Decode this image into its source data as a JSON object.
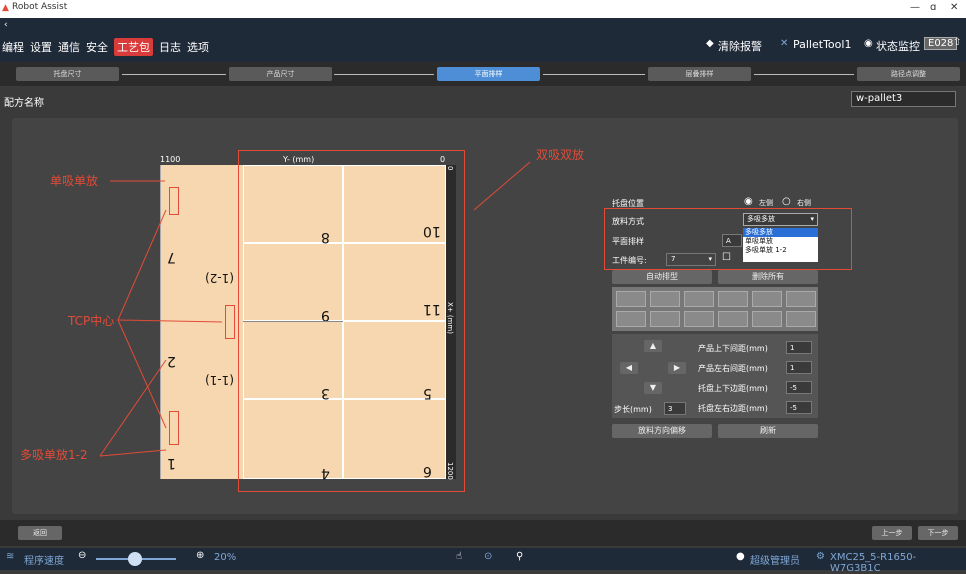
{
  "app_title": "Robot Assist",
  "window_controls": {
    "minimize": "—",
    "restore": "ɑ",
    "close": "✕"
  },
  "menu": {
    "items": [
      "编程",
      "设置",
      "通信",
      "安全",
      "工艺包",
      "日志",
      "选项"
    ],
    "active_index": 4
  },
  "toolbar": {
    "clear_alarm": "清除报警",
    "tool": "PalletTool1",
    "status_monitor": "状态监控",
    "code": "E028"
  },
  "steps": [
    "托盘尺寸",
    "产品尺寸",
    "平面排样",
    "层叠排样",
    "路径点调整"
  ],
  "active_step": 2,
  "recipe": {
    "label": "配方名称",
    "value": "w-pallet3"
  },
  "pallet": {
    "y_axis": "Y- (mm)",
    "x_axis": "X+ (mm)",
    "y_max": "1100",
    "y_min": "0",
    "x_min": "0",
    "x_max": "1200",
    "labels": {
      "c1": "1",
      "c2": "2",
      "c3": "3",
      "c4": "4",
      "c5": "5",
      "c6": "6",
      "c7": "7",
      "c8": "8",
      "c9": "9",
      "c10": "10",
      "c11": "11",
      "g1": "(1-1)",
      "g2": "(1-2)"
    }
  },
  "annotations": {
    "single": "单吸单放",
    "double": "双吸双放",
    "tcp": "TCP中心",
    "multi": "多吸单放1-2"
  },
  "panel": {
    "pallet_pos": "托盘位置",
    "left": "左侧",
    "right": "右侧",
    "place_mode": "放料方式",
    "place_mode_value": "多吸多放",
    "options": [
      "多吸多放",
      "单吸单放",
      "多吸单放 1-2"
    ],
    "plane_layout": "平面排样",
    "plane_value": "A",
    "workpiece_no": "工件编号:",
    "workpiece_value": "7",
    "auto_layout": "自动排型",
    "delete_all": "删除所有",
    "up_gap": "产品上下间距(mm)",
    "up_gap_val": "1",
    "lr_gap": "产品左右间距(mm)",
    "lr_gap_val": "1",
    "pallet_ud": "托盘上下边距(mm)",
    "pallet_ud_val": "-5",
    "pallet_lr": "托盘左右边距(mm)",
    "pallet_lr_val": "-5",
    "step_len": "步长(mm)",
    "step_val": "3",
    "offset": "放料方向偏移",
    "refresh": "刷新"
  },
  "bottom": {
    "back": "返回",
    "prev": "上一步",
    "next": "下一步"
  },
  "status": {
    "speed_label": "程序速度",
    "speed_pct": "20%",
    "speed_value": 20,
    "user": "超级管理员",
    "model": "XMC25_5-R1650-W7G3B1C"
  },
  "colors": {
    "accent": "#4d8ed6",
    "alert": "#e34b37",
    "pallet": "#f7d7b0"
  }
}
